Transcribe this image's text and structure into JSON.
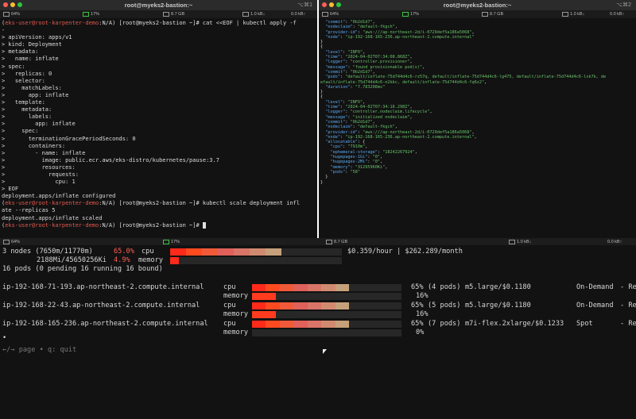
{
  "windows": {
    "left_title": "root@myeks2-bastion:~",
    "right_title": "root@myeks2-bastion:~",
    "shortcut_left": "⌥⌘1",
    "shortcut_right": "⌥⌘2"
  },
  "statusbars": {
    "left_top": {
      "cpu": "64%",
      "mem": "17%",
      "disk": "8.7 GB",
      "net_down": "1.0 kB↓",
      "net_up": "0.0 kB↑"
    },
    "right_top": {
      "cpu": "64%",
      "mem": "17%",
      "disk": "8.7 GB",
      "net_down": "1.0 kB↓",
      "net_up": "0.0 kB↑"
    },
    "bottom_left": {
      "cpu": "64%",
      "mem": "17%"
    },
    "bottom_right": {
      "disk": "8.7 GB",
      "net_down": "1.0 kB↓",
      "net_up": "0.0 kB↑"
    }
  },
  "left_terminal": {
    "prompt_user": "eks-user@root-karpenter-demo",
    "prompt_rest": ":N/A) [root@myeks2-bastion ~]#",
    "cmd1": " cat <<EOF | kubectl apply -f",
    "cmd1_cont": "-",
    "yaml": [
      "> apiVersion: apps/v1",
      "> kind: Deployment",
      "> metadata:",
      ">   name: inflate",
      "> spec:",
      ">   replicas: 0",
      ">   selector:",
      ">     matchLabels:",
      ">       app: inflate",
      ">   template:",
      ">     metadata:",
      ">       labels:",
      ">         app: inflate",
      ">     spec:",
      ">       terminationGracePeriodSeconds: 0",
      ">       containers:",
      ">         - name: inflate",
      ">           image: public.ecr.aws/eks-distro/kubernetes/pause:3.7",
      ">           resources:",
      ">             requests:",
      ">               cpu: 1",
      "> EOF"
    ],
    "out1": "deployment.apps/inflate configured",
    "cmd2": " kubectl scale deployment infl",
    "cmd2_cont": "ate --replicas 5",
    "out2": "deployment.apps/inflate scaled"
  },
  "right_log": [
    [
      [
        "k",
        "  \"commit\""
      ],
      [
        "n",
        ": "
      ],
      [
        "s",
        "\"0b2d1d7\""
      ],
      [
        "n",
        ","
      ]
    ],
    [
      [
        "k",
        "  \"nodeclaim\""
      ],
      [
        "n",
        ": "
      ],
      [
        "s",
        "\"default-fkgch\""
      ],
      [
        "n",
        ","
      ]
    ],
    [
      [
        "k",
        "  \"provider-id\""
      ],
      [
        "n",
        ": "
      ],
      [
        "s",
        "\"aws:///ap-northeast-2d/i-0729def5a186a5068\""
      ],
      [
        "n",
        ","
      ]
    ],
    [
      [
        "k",
        "  \"node\""
      ],
      [
        "n",
        ": "
      ],
      [
        "s",
        "\"ip-192-168-165-236.ap-northeast-2.compute.internal\""
      ]
    ],
    [
      [
        "n",
        "}"
      ]
    ],
    [
      [
        "n",
        "{"
      ]
    ],
    [
      [
        "k",
        "  \"level\""
      ],
      [
        "n",
        ": "
      ],
      [
        "s",
        "\"INFO\""
      ],
      [
        "n",
        ","
      ]
    ],
    [
      [
        "k",
        "  \"time\""
      ],
      [
        "n",
        ": "
      ],
      [
        "s",
        "\"2024-04-02T07:34:08.868Z\""
      ],
      [
        "n",
        ","
      ]
    ],
    [
      [
        "k",
        "  \"logger\""
      ],
      [
        "n",
        ": "
      ],
      [
        "s",
        "\"controller.provisioner\""
      ],
      [
        "n",
        ","
      ]
    ],
    [
      [
        "k",
        "  \"message\""
      ],
      [
        "n",
        ": "
      ],
      [
        "s",
        "\"found provisionable pod(s)\""
      ],
      [
        "n",
        ","
      ]
    ],
    [
      [
        "k",
        "  \"commit\""
      ],
      [
        "n",
        ": "
      ],
      [
        "s",
        "\"0b2d1d7\""
      ],
      [
        "n",
        ","
      ]
    ],
    [
      [
        "k",
        "  \"pods\""
      ],
      [
        "n",
        ": "
      ],
      [
        "s",
        "\"default/inflate-75d744d4c6-rz57q, default/inflate-75d744d4c6-lg475, default/inflate-75d744d4c6-lsk7k, de"
      ]
    ],
    [
      [
        "s",
        "efault/inflate-75d744d4c6-n2kkc, default/inflate-75d744d4c6-fq6z2\""
      ],
      [
        "n",
        ","
      ]
    ],
    [
      [
        "k",
        "  \"duration\""
      ],
      [
        "n",
        ": "
      ],
      [
        "s",
        "\"7.783208ms\""
      ]
    ],
    [
      [
        "n",
        "}"
      ]
    ],
    [
      [
        "n",
        "{"
      ]
    ],
    [
      [
        "k",
        "  \"level\""
      ],
      [
        "n",
        ": "
      ],
      [
        "s",
        "\"INFO\""
      ],
      [
        "n",
        ","
      ]
    ],
    [
      [
        "k",
        "  \"time\""
      ],
      [
        "n",
        ": "
      ],
      [
        "s",
        "\"2024-04-02T07:34:16.298Z\""
      ],
      [
        "n",
        ","
      ]
    ],
    [
      [
        "k",
        "  \"logger\""
      ],
      [
        "n",
        ": "
      ],
      [
        "s",
        "\"controller.nodeclaim.lifecycle\""
      ],
      [
        "n",
        ","
      ]
    ],
    [
      [
        "k",
        "  \"message\""
      ],
      [
        "n",
        ": "
      ],
      [
        "s",
        "\"initialized nodeclaim\""
      ],
      [
        "n",
        ","
      ]
    ],
    [
      [
        "k",
        "  \"commit\""
      ],
      [
        "n",
        ": "
      ],
      [
        "s",
        "\"0b2d1d7\""
      ],
      [
        "n",
        ","
      ]
    ],
    [
      [
        "k",
        "  \"nodeclaim\""
      ],
      [
        "n",
        ": "
      ],
      [
        "s",
        "\"default-fkgch\""
      ],
      [
        "n",
        ","
      ]
    ],
    [
      [
        "k",
        "  \"provider-id\""
      ],
      [
        "n",
        ": "
      ],
      [
        "s",
        "\"aws:///ap-northeast-2d/i-0729def5a186a5068\""
      ],
      [
        "n",
        ","
      ]
    ],
    [
      [
        "k",
        "  \"node\""
      ],
      [
        "n",
        ": "
      ],
      [
        "s",
        "\"ip-192-168-165-236.ap-northeast-2.compute.internal\""
      ],
      [
        "n",
        ","
      ]
    ],
    [
      [
        "k",
        "  \"allocatable\""
      ],
      [
        "n",
        ": {"
      ]
    ],
    [
      [
        "k",
        "    \"cpu\""
      ],
      [
        "n",
        ": "
      ],
      [
        "s",
        "\"7910m\""
      ],
      [
        "n",
        ","
      ]
    ],
    [
      [
        "k",
        "    \"ephemeral-storage\""
      ],
      [
        "n",
        ": "
      ],
      [
        "s",
        "\"18242267924\""
      ],
      [
        "n",
        ","
      ]
    ],
    [
      [
        "k",
        "    \"hugepages-1Gi\""
      ],
      [
        "n",
        ": "
      ],
      [
        "s",
        "\"0\""
      ],
      [
        "n",
        ","
      ]
    ],
    [
      [
        "k",
        "    \"hugepages-2Mi\""
      ],
      [
        "n",
        ": "
      ],
      [
        "s",
        "\"0\""
      ],
      [
        "n",
        ","
      ]
    ],
    [
      [
        "k",
        "    \"memory\""
      ],
      [
        "n",
        ": "
      ],
      [
        "s",
        "\"31295960Ki\""
      ],
      [
        "n",
        ","
      ]
    ],
    [
      [
        "k",
        "    \"pods\""
      ],
      [
        "n",
        ": "
      ],
      [
        "s",
        "\"58\""
      ]
    ],
    [
      [
        "n",
        "  }"
      ]
    ],
    [
      [
        "n",
        "}"
      ]
    ]
  ],
  "viewer": {
    "summary": {
      "nodes": "3 nodes (7650m/11770m)",
      "cpu_pct": "65.0%",
      "cpu_label": "cpu",
      "mem": "2188Mi/45650256Ki",
      "mem_pct": "4.9%",
      "mem_label": "memory",
      "pods": "16 pods (0 pending 16 running 16 bound)",
      "price": "$0.359/hour | $262.289/month",
      "cpu_fill": 0.65,
      "mem_fill": 0.049
    },
    "nodes": [
      {
        "name": "ip-192-168-71-193.ap-northeast-2.compute.internal",
        "cpu_label": "cpu",
        "mem_label": "memory",
        "cpu_pct": "65%",
        "pods": "(4 pods)",
        "type": "m5.large/$0.1180",
        "capacity": "On-Demand",
        "status": "- Re",
        "mem_pct": "16%",
        "cpu_fill": 0.65,
        "mem_fill": 0.16
      },
      {
        "name": "ip-192-168-22-43.ap-northeast-2.compute.internal",
        "cpu_label": "cpu",
        "mem_label": "memory",
        "cpu_pct": "65%",
        "pods": "(5 pods)",
        "type": "m5.large/$0.1180",
        "capacity": "On-Demand",
        "status": "- Re",
        "mem_pct": "16%",
        "cpu_fill": 0.65,
        "mem_fill": 0.16
      },
      {
        "name": "ip-192-168-165-236.ap-northeast-2.compute.internal",
        "cpu_label": "cpu",
        "mem_label": "memory",
        "cpu_pct": "65%",
        "pods": "(7 pods)",
        "type": "m7i-flex.2xlarge/$0.1233",
        "capacity": "Spot",
        "status": "- Re",
        "mem_pct": "0%",
        "cpu_fill": 0.65,
        "mem_fill": 0.0
      }
    ],
    "dot": "•",
    "help": "←/→ page • q: quit"
  }
}
